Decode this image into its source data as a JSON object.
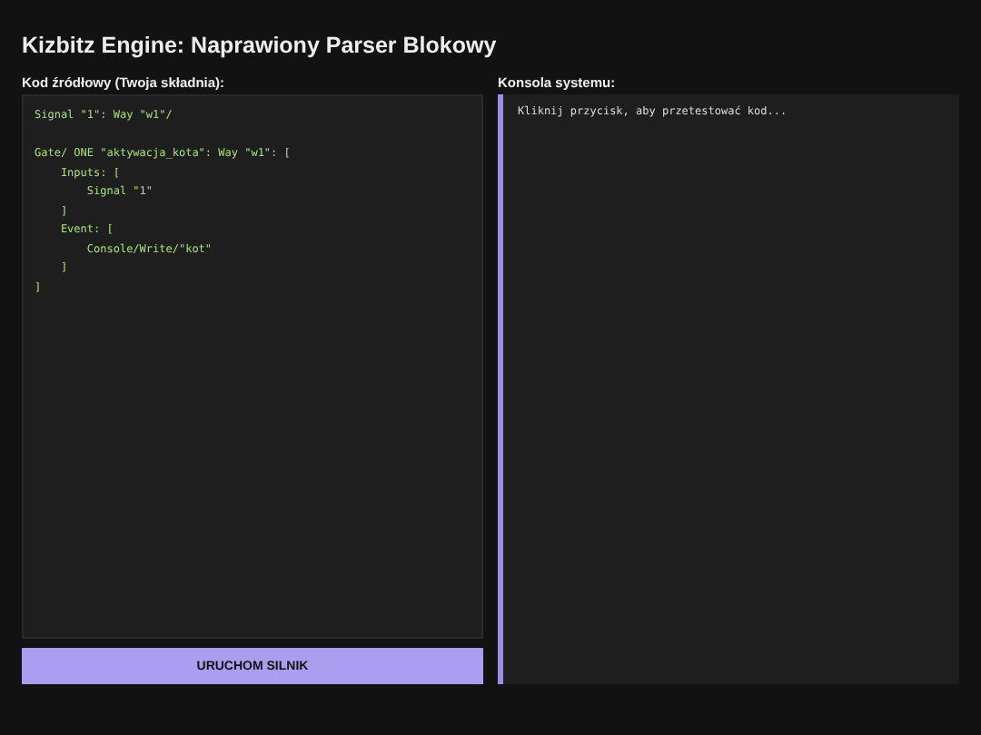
{
  "title": "Kizbitz Engine: Naprawiony Parser Blokowy",
  "editor": {
    "label": "Kod źródłowy (Twoja składnia):",
    "value": "Signal \"1\": Way \"w1\"/\n\nGate/ ONE \"aktywacja_kota\": Way \"w1\": [\n    Inputs: [\n        Signal \"1\"\n    ]\n    Event: [\n        Console/Write/\"kot\"\n    ]\n]"
  },
  "run_button": {
    "label": "URUCHOM SILNIK"
  },
  "console": {
    "label": "Konsola systemu:",
    "output": "Kliknij przycisk, aby przetestować kod..."
  }
}
